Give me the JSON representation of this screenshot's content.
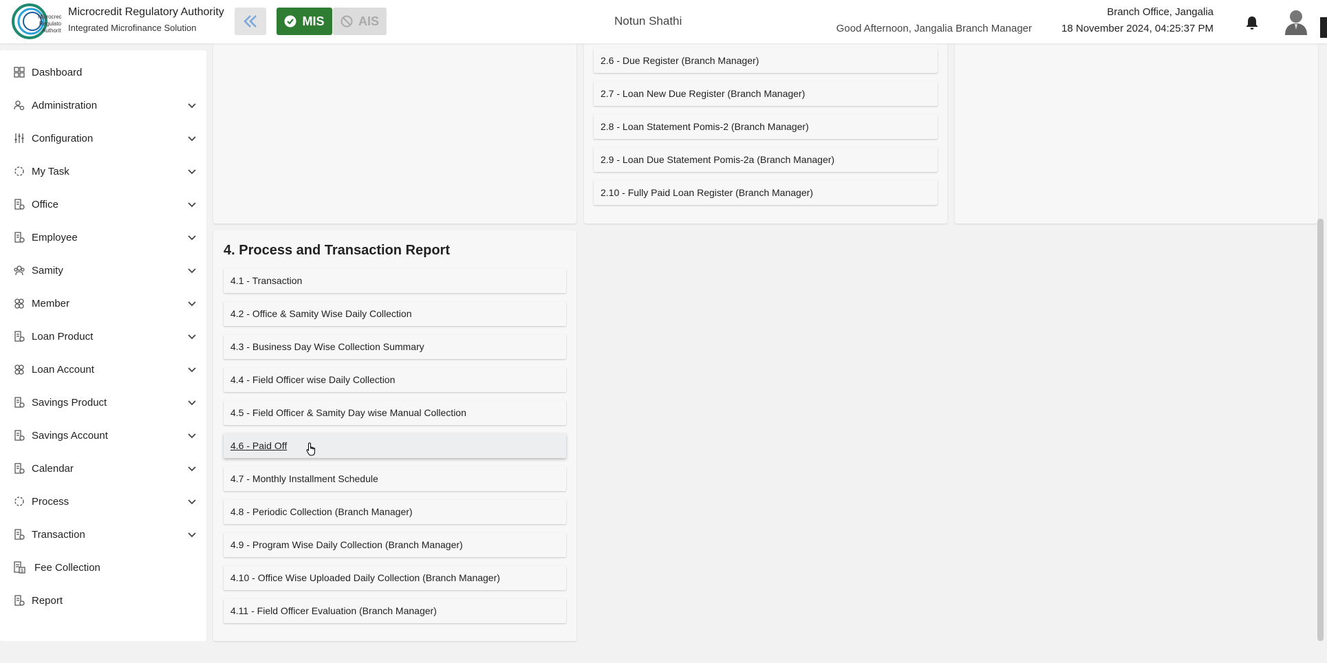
{
  "header": {
    "org_name": "Microcredit Regulatory Authority",
    "org_sub": "Integrated Microfinance Solution",
    "logo_text": "Microcredit Regulatory Authority",
    "mis_label": "MIS",
    "ais_label": "AIS",
    "app_name": "Notun Shathi",
    "greeting": "Good Afternoon, Jangalia Branch Manager",
    "branch": "Branch Office, Jangalia",
    "datetime": "18 November 2024, 04:25:37 PM"
  },
  "sidebar": {
    "items": [
      {
        "label": "Dashboard",
        "icon": "grid-icon",
        "expandable": false
      },
      {
        "label": "Administration",
        "icon": "admin-icon",
        "expandable": true
      },
      {
        "label": "Configuration",
        "icon": "sliders-icon",
        "expandable": true
      },
      {
        "label": "My Task",
        "icon": "dashed-circle-icon",
        "expandable": true
      },
      {
        "label": "Office",
        "icon": "document-icon",
        "expandable": true
      },
      {
        "label": "Employee",
        "icon": "document-icon",
        "expandable": true
      },
      {
        "label": "Samity",
        "icon": "group-icon",
        "expandable": true
      },
      {
        "label": "Member",
        "icon": "members-icon",
        "expandable": true
      },
      {
        "label": "Loan Product",
        "icon": "document-icon",
        "expandable": true
      },
      {
        "label": "Loan Account",
        "icon": "members-icon",
        "expandable": true
      },
      {
        "label": "Savings Product",
        "icon": "document-icon",
        "expandable": true
      },
      {
        "label": "Savings Account",
        "icon": "document-icon",
        "expandable": true
      },
      {
        "label": "Calendar",
        "icon": "document-icon",
        "expandable": true
      },
      {
        "label": "Process",
        "icon": "dashed-circle-icon",
        "expandable": true
      },
      {
        "label": "Transaction",
        "icon": "document-icon",
        "expandable": true
      },
      {
        "label": "Fee Collection",
        "icon": "fee-icon",
        "expandable": false
      },
      {
        "label": "Report",
        "icon": "document-icon",
        "expandable": false
      }
    ]
  },
  "loan_reports": [
    "2.6 - Due Register (Branch Manager)",
    "2.7 - Loan New Due Register (Branch Manager)",
    "2.8 - Loan Statement Pomis-2 (Branch Manager)",
    "2.9 - Loan Due Statement Pomis-2a (Branch Manager)",
    "2.10 - Fully Paid Loan Register (Branch Manager)"
  ],
  "process_section": {
    "title": "4. Process and Transaction Report",
    "items": [
      "4.1 - Transaction",
      "4.2 - Office & Samity Wise Daily Collection",
      "4.3 - Business Day Wise Collection Summary",
      "4.4 - Field Officer wise Daily Collection",
      "4.5 - Field Officer & Samity Day wise Manual Collection",
      "4.6 - Paid Off",
      "4.7 - Monthly Installment Schedule",
      "4.8 - Periodic Collection (Branch Manager)",
      "4.9 - Program Wise Daily Collection (Branch Manager)",
      "4.10 - Office Wise Uploaded Daily Collection (Branch Manager)",
      "4.11 - Field Officer Evaluation (Branch Manager)"
    ],
    "hovered_index": 5
  },
  "colors": {
    "mis_green": "#2e7d32",
    "collapse_arrow": "#7aa7d9",
    "disabled_grey": "#dcdcdc"
  }
}
